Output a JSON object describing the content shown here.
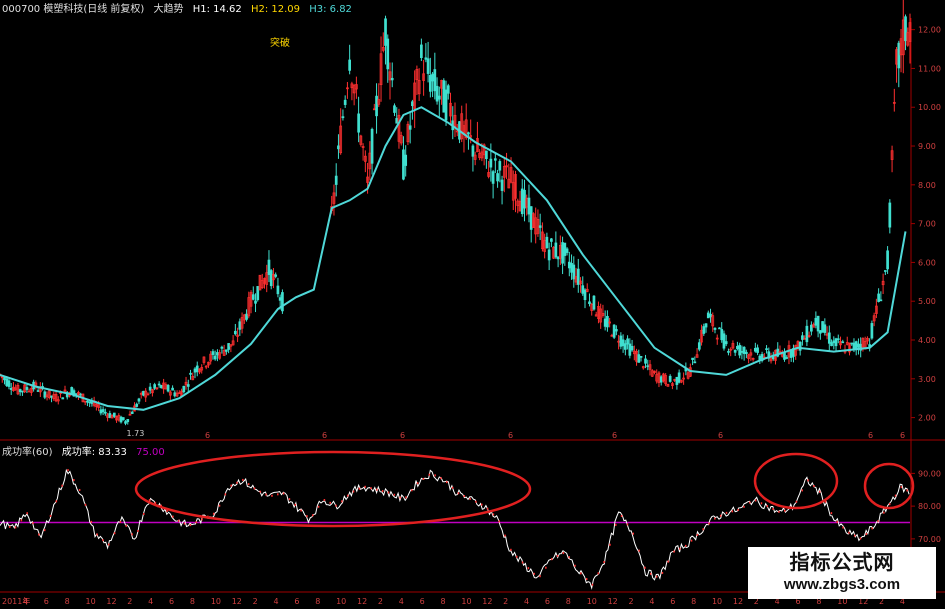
{
  "header": {
    "code_name": "000700 模塑科技(日线 前复权)",
    "indicator_name": "大趋势",
    "h1": "H1: 14.62",
    "h2": "H2: 12.09",
    "h3": "H3: 6.82"
  },
  "annotation_top": "突破",
  "indicator_header": {
    "name": "成功率(60)",
    "value": "成功率: 83.33",
    "level": "75.00"
  },
  "watermark": {
    "line1": "指标公式网",
    "line2": "www.zbgs3.com"
  },
  "colors": {
    "background": "#000000",
    "grid_red": "#a00000",
    "ma_line": "#4fd8d8",
    "candle_up": "#ff3030",
    "candle_down": "#40e0d0",
    "indicator_line": "#ffffff",
    "level_line": "#c000c0",
    "highlight_circle": "#e02020",
    "title_yellow": "#ffd700"
  },
  "chart_data": [
    {
      "type": "line",
      "title": "大趋势",
      "series": [
        {
          "name": "price",
          "x": [
            0,
            4,
            8,
            12,
            16,
            20,
            24,
            28,
            32,
            36,
            40,
            44,
            48,
            52,
            56,
            60,
            62,
            63,
            66,
            70,
            74,
            78,
            82,
            86,
            90,
            94,
            98,
            100,
            103,
            106,
            110,
            114,
            118,
            122,
            126,
            130,
            134,
            138,
            142,
            146,
            150,
            154,
            158,
            162,
            166,
            170,
            174,
            178,
            182,
            186,
            190,
            194,
            198,
            200,
            202
          ],
          "values": [
            3.1,
            2.7,
            2.8,
            2.5,
            2.7,
            2.4,
            2.1,
            1.9,
            2.6,
            2.8,
            2.6,
            3.3,
            3.6,
            3.9,
            5.0,
            5.8,
            5.3,
            5.0,
            5.1,
            5.4,
            7.1,
            11.4,
            8.0,
            12.0,
            8.5,
            11.2,
            10.3,
            10.1,
            9.4,
            8.9,
            8.4,
            8.1,
            7.3,
            6.4,
            6.2,
            5.4,
            4.6,
            4.1,
            3.6,
            3.1,
            2.9,
            3.2,
            4.6,
            3.9,
            3.7,
            3.6,
            3.6,
            3.8,
            4.5,
            3.9,
            3.8,
            4.0,
            6.0,
            11.0,
            12.0
          ]
        },
        {
          "name": "ma",
          "x": [
            0,
            8,
            16,
            24,
            32,
            40,
            48,
            56,
            62,
            66,
            70,
            74,
            78,
            82,
            86,
            90,
            94,
            100,
            106,
            114,
            122,
            130,
            138,
            146,
            154,
            162,
            170,
            178,
            186,
            194,
            198,
            202
          ],
          "values": [
            3.1,
            2.8,
            2.6,
            2.3,
            2.2,
            2.5,
            3.1,
            3.9,
            4.8,
            5.1,
            5.3,
            7.4,
            7.6,
            7.9,
            9.0,
            9.8,
            10.0,
            9.6,
            9.1,
            8.6,
            7.6,
            6.2,
            5.0,
            3.8,
            3.2,
            3.1,
            3.5,
            3.8,
            3.7,
            3.8,
            4.2,
            6.8
          ]
        }
      ],
      "yticks": [
        "12.00",
        "11.00",
        "10.00",
        "9.00",
        "8.00",
        "7.00",
        "6.00",
        "5.00",
        "4.00",
        "3.00",
        "2.00"
      ],
      "ylim": [
        1.5,
        12.3
      ],
      "annotations": [
        "1.73"
      ]
    },
    {
      "type": "line",
      "title": "成功率(60)",
      "series": [
        {
          "name": "成功率",
          "x": [
            0,
            3,
            6,
            9,
            12,
            15,
            18,
            21,
            24,
            27,
            30,
            33,
            36,
            39,
            42,
            45,
            48,
            51,
            54,
            57,
            60,
            63,
            66,
            69,
            72,
            75,
            78,
            81,
            84,
            87,
            90,
            93,
            96,
            99,
            102,
            105,
            108,
            111,
            114,
            117,
            120,
            123,
            126,
            129,
            132,
            135,
            138,
            141,
            144,
            147,
            150,
            153,
            156,
            159,
            162,
            165,
            168,
            171,
            174,
            177,
            180,
            183,
            186,
            189,
            192,
            195,
            198,
            201,
            203
          ],
          "values": [
            75,
            73,
            78,
            70,
            80,
            91,
            84,
            72,
            68,
            76,
            70,
            82,
            80,
            76,
            74,
            76,
            78,
            86,
            88,
            85,
            83,
            84,
            80,
            76,
            82,
            80,
            84,
            86,
            85,
            84,
            82,
            87,
            90,
            88,
            84,
            82,
            80,
            76,
            66,
            62,
            58,
            64,
            66,
            60,
            56,
            64,
            78,
            72,
            60,
            58,
            66,
            68,
            72,
            76,
            78,
            79,
            82,
            80,
            78,
            80,
            88,
            84,
            76,
            72,
            70,
            74,
            80,
            86,
            84
          ]
        }
      ],
      "yticks": [
        "90.00",
        "80.00",
        "70.00"
      ],
      "ylim": [
        55,
        95
      ],
      "level": 75
    }
  ],
  "x_axis_labels": [
    "2011年",
    "4",
    "6",
    "8",
    "10",
    "12",
    "2",
    "4",
    "6",
    "8",
    "10",
    "12",
    "2",
    "4",
    "6",
    "8",
    "10",
    "12",
    "2",
    "4",
    "6",
    "8",
    "10",
    "12",
    "2",
    "4",
    "6",
    "8",
    "10",
    "12",
    "2",
    "4",
    "6",
    "8",
    "10",
    "12",
    "2",
    "4",
    "6",
    "8",
    "10",
    "12",
    "2",
    "4"
  ],
  "main_axis_markers": [
    "6",
    "6",
    "6",
    "6",
    "6",
    "6",
    "6",
    "6",
    "财",
    "财"
  ]
}
